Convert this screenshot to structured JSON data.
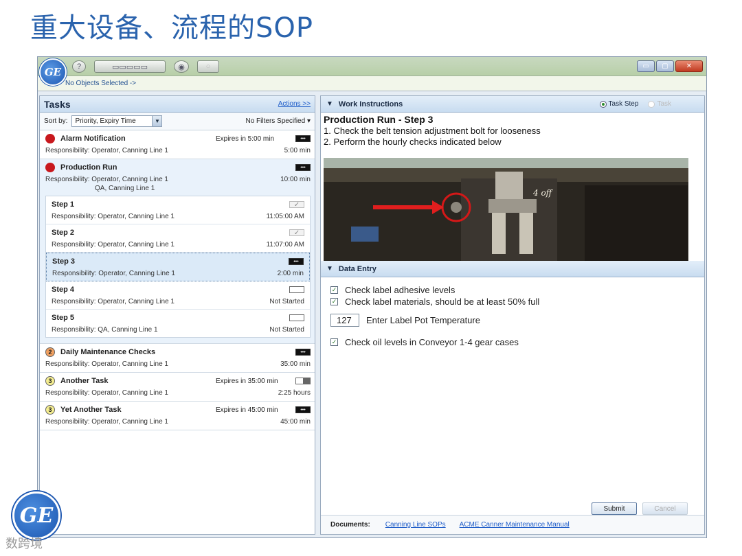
{
  "slide": {
    "title": "重大设备、流程的SOP",
    "watermark": "数跨境"
  },
  "app": {
    "logo": "GE",
    "toolbar_icons": [
      "help-icon",
      "layout-icon",
      "settings-icon",
      "info-icon"
    ],
    "selection_text": "No Objects Selected  ->",
    "window_controls": {
      "minimize": "▭",
      "maximize": "▢",
      "close": "✕"
    }
  },
  "tasks_panel": {
    "title": "Tasks",
    "actions_link": "Actions >>",
    "sort_label": "Sort by:",
    "sort_value": "Priority, Expiry Time",
    "filters": "No Filters Specified",
    "tasks": [
      {
        "name": "Alarm Notification",
        "expires": "Expires in 5:00 min",
        "responsibility": "Responsibility:  Operator, Canning Line 1",
        "time": "5:00 min",
        "priority": "red"
      },
      {
        "name": "Production Run",
        "expires": "",
        "responsibility": "Responsibility:  Operator, Canning Line 1",
        "responsibility2": "QA, Canning Line 1",
        "time": "10:00 min",
        "priority": "red",
        "steps": [
          {
            "name": "Step 1",
            "responsibility": "Responsibility:  Operator, Canning Line 1",
            "time": "11:05:00 AM"
          },
          {
            "name": "Step 2",
            "responsibility": "Responsibility:  Operator, Canning Line 1",
            "time": "11:07:00 AM"
          },
          {
            "name": "Step 3",
            "responsibility": "Responsibility:  Operator, Canning Line 1",
            "time": "2:00 min"
          },
          {
            "name": "Step 4",
            "responsibility": "Responsibility:  Operator, Canning Line 1",
            "time": "Not Started"
          },
          {
            "name": "Step 5",
            "responsibility": "Responsibility:  QA, Canning Line 1",
            "time": "Not Started"
          }
        ]
      },
      {
        "name": "Daily Maintenance Checks",
        "expires": "",
        "responsibility": "Responsibility:  Operator, Canning Line 1",
        "time": "35:00 min",
        "priority": "2"
      },
      {
        "name": "Another Task",
        "expires": "Expires in 35:00 min",
        "responsibility": "Responsibility:  Operator, Canning Line 1",
        "time": "2:25 hours",
        "priority": "3"
      },
      {
        "name": "Yet Another Task",
        "expires": "Expires in 45:00 min",
        "responsibility": "Responsibility:  Operator, Canning Line 1",
        "time": "45:00 min",
        "priority": "3"
      }
    ]
  },
  "work_instructions": {
    "header": "Work Instructions",
    "radio_task_step": "Task Step",
    "radio_task": "Task",
    "title": "Production Run - Step 3",
    "lines": [
      "1.  Check the belt tension adjustment bolt for looseness",
      "2.  Perform the hourly checks indicated below"
    ],
    "photo_annotation": "4 off"
  },
  "data_entry": {
    "header": "Data Entry",
    "check1": "Check label adhesive levels",
    "check2": "Check label materials, should be at least 50% full",
    "temp_value": "127",
    "temp_label": "Enter Label Pot Temperature",
    "check3": "Check oil levels in Conveyor 1-4 gear cases",
    "submit": "Submit",
    "cancel": "Cancel"
  },
  "documents": {
    "label": "Documents:",
    "links": [
      "Canning Line SOPs",
      "ACME Canner Maintenance Manual"
    ]
  },
  "colors": {
    "title_blue": "#2a63ad",
    "priority_red": "#c8181d",
    "link_blue": "#1e5cc8"
  }
}
